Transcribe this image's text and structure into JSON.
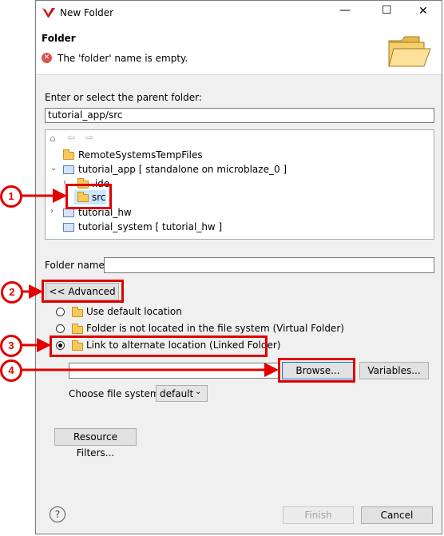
{
  "window": {
    "title": "New Folder",
    "minimize": "—",
    "maximize": "☐",
    "close": "✕"
  },
  "header": {
    "title": "Folder",
    "error_message": "The 'folder' name is empty."
  },
  "parent": {
    "label": "Enter or select the parent folder:",
    "value": "tutorial_app/src"
  },
  "tree": {
    "items": [
      {
        "label": "RemoteSystemsTempFiles"
      },
      {
        "label": "tutorial_app [ standalone on microblaze_0 ]"
      },
      {
        "label": ".ide"
      },
      {
        "label": "src"
      },
      {
        "label": "tutorial_hw"
      },
      {
        "label": "tutorial_system [ tutorial_hw ]"
      }
    ]
  },
  "folder_name": {
    "label": "Folder name:",
    "value": ""
  },
  "advanced_button": "<< Advanced",
  "location_options": [
    {
      "label": "Use default location",
      "selected": false
    },
    {
      "label": "Folder is not located in the file system (Virtual Folder)",
      "selected": false
    },
    {
      "label": "Link to alternate location (Linked Folder)",
      "selected": true
    }
  ],
  "link_location": {
    "value": "",
    "browse_label": "Browse...",
    "variables_label": "Variables..."
  },
  "file_system": {
    "label": "Choose file system:",
    "value": "default"
  },
  "resource_filters_label": "Resource Filters...",
  "footer": {
    "help": "?",
    "finish_label": "Finish",
    "cancel_label": "Cancel"
  },
  "callouts": [
    "1",
    "2",
    "3",
    "4"
  ],
  "colors": {
    "annotation": "#e00000",
    "accent_logo": "#c4161c"
  }
}
